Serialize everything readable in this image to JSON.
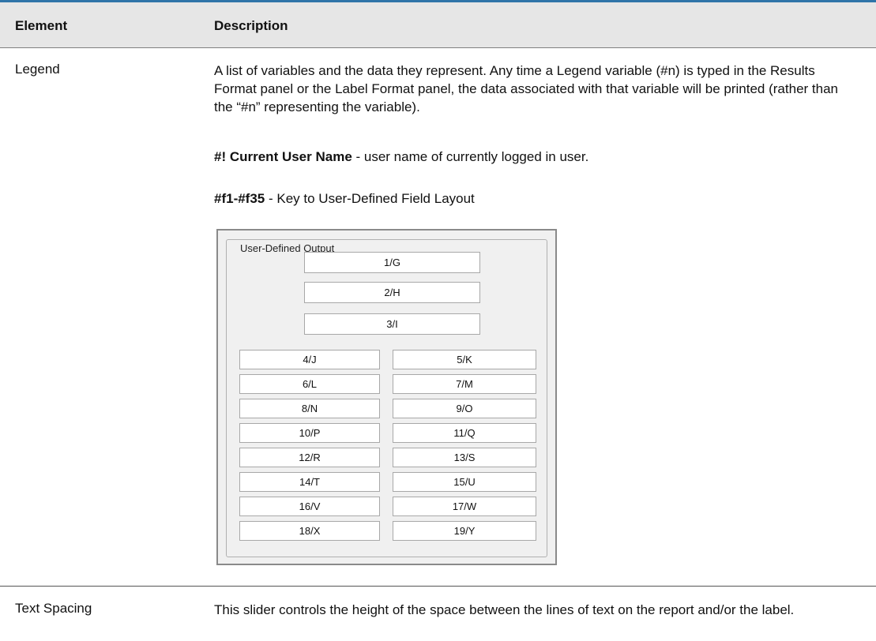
{
  "table": {
    "header": {
      "element": "Element",
      "description": "Description"
    },
    "legend_row": {
      "label": "Legend",
      "description": "A list of variables and the data they represent. Any time a Legend variable (#n) is typed in the Results Format panel or the Label Format panel, the data associated with that variable will be printed (rather than the “#n” representing the variable).",
      "item1_bold": "#! Current User Name",
      "item1_text": " - user name of currently logged in user.",
      "item2_bold": "#f1-#f35",
      "item2_text": " - Key to User-Defined Field Layout"
    },
    "text_spacing_row": {
      "label": "Text Spacing",
      "description": "This slider controls the height of the space between the lines of text on the report and/or the label."
    }
  },
  "dialog": {
    "group_title": "User-Defined Output",
    "top_fields": [
      "1/G",
      "2/H",
      "3/I"
    ],
    "left_fields": [
      "4/J",
      "6/L",
      "8/N",
      "10/P",
      "12/R",
      "14/T",
      "16/V",
      "18/X"
    ],
    "right_fields": [
      "5/K",
      "7/M",
      "9/O",
      "11/Q",
      "13/S",
      "15/U",
      "17/W",
      "19/Y"
    ]
  }
}
